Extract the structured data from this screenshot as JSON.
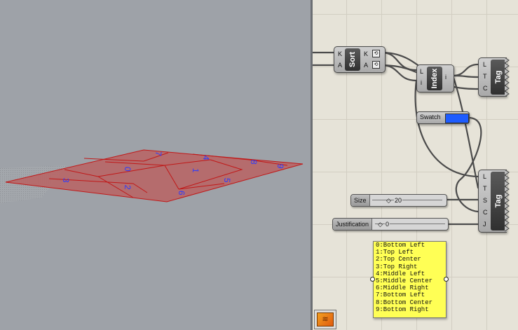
{
  "sort": {
    "title": "Sort",
    "inputs": [
      "K",
      "A"
    ],
    "outputs": [
      "K",
      "A"
    ]
  },
  "index": {
    "title": "Index",
    "inputs": [
      "L",
      "i"
    ],
    "outputs": [
      "i"
    ]
  },
  "tag_top": {
    "title": "Tag",
    "inputs": [
      "L",
      "T",
      "C"
    ]
  },
  "tag_bottom": {
    "title": "Tag",
    "inputs": [
      "L",
      "T",
      "S",
      "C",
      "J"
    ]
  },
  "swatch": {
    "label": "Swatch",
    "color": "#1e5cff"
  },
  "size_slider": {
    "label": "Size",
    "value": "20"
  },
  "justification_slider": {
    "label": "Justification",
    "value": "0"
  },
  "panel": {
    "lines": [
      "0:Bottom Left",
      "1:Top Left",
      "2:Top Center",
      "3:Top Right",
      "4:Middle Left",
      "5:Middle Center",
      "6:Middle Right",
      "7:Bottom Left",
      "8:Bottom Center",
      "9:Bottom Right"
    ]
  },
  "viewport": {
    "tag_labels": [
      "0",
      "1",
      "2",
      "3",
      "4",
      "5",
      "6",
      "7",
      "8",
      "9"
    ],
    "tag_color": "#2a3bff",
    "surface_color": "#b96363"
  }
}
